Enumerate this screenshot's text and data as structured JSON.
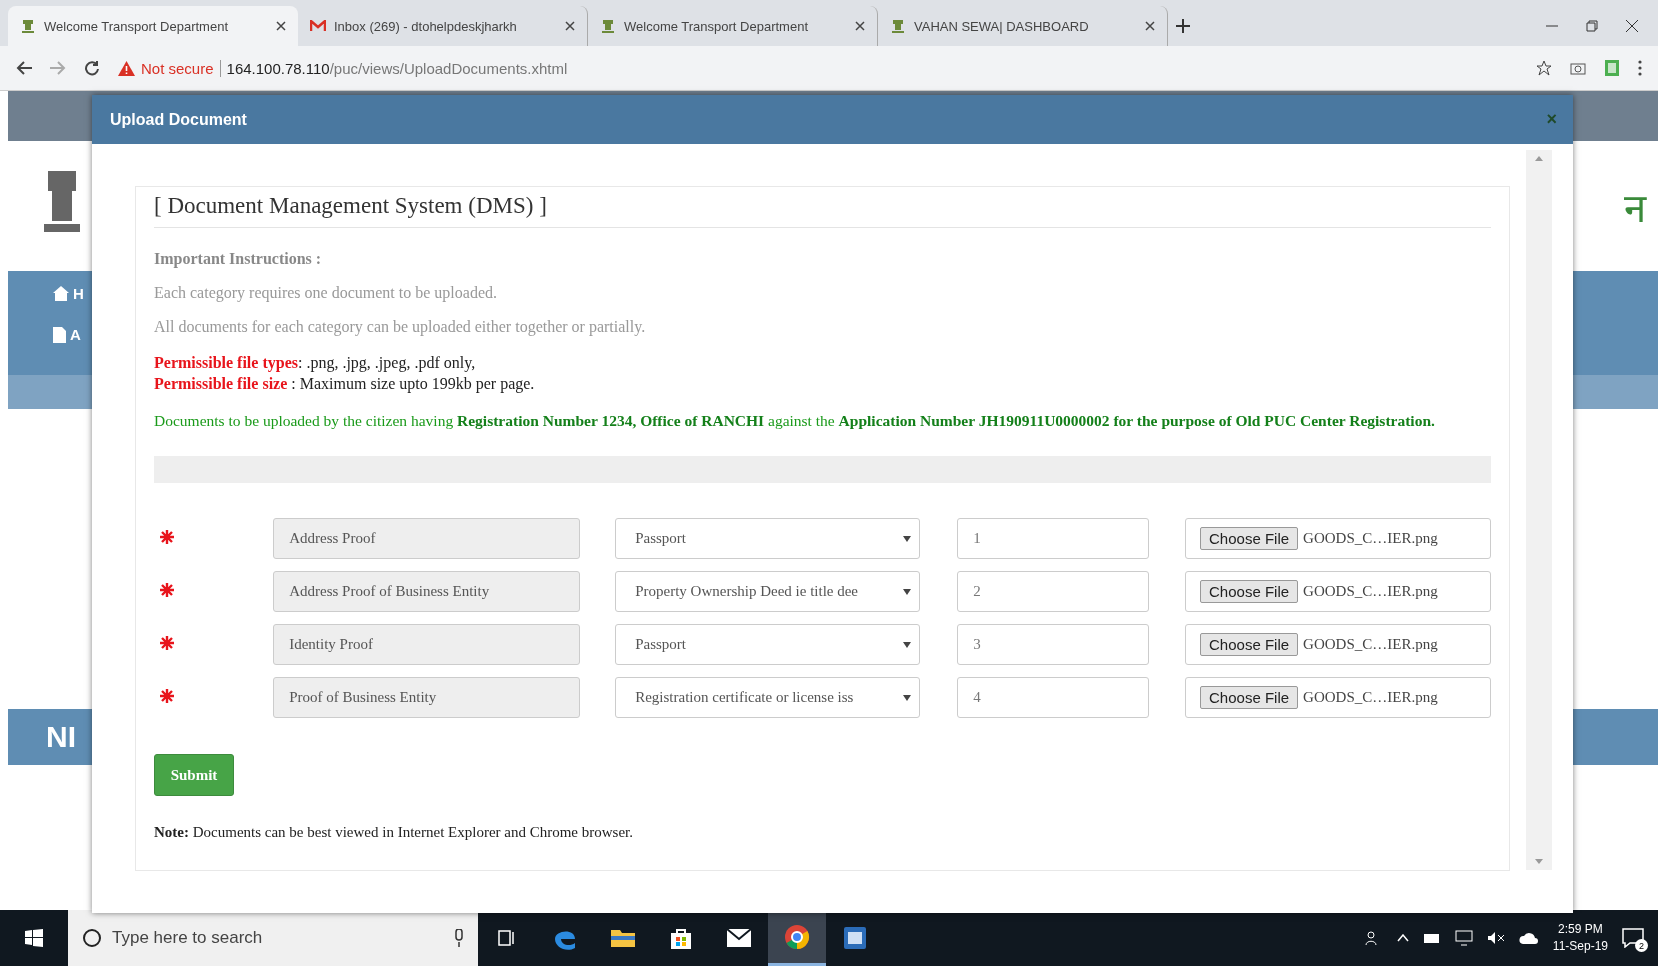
{
  "browser": {
    "tabs": [
      {
        "title": "Welcome Transport Department",
        "kind": "emblem",
        "selected": true
      },
      {
        "title": "Inbox (269) - dtohelpdeskjharkh",
        "kind": "mail",
        "selected": false
      },
      {
        "title": "Welcome Transport Department",
        "kind": "emblem",
        "selected": false
      },
      {
        "title": "VAHAN SEWA| DASHBOARD",
        "kind": "emblem",
        "selected": false
      }
    ],
    "security": "Not secure",
    "url_host": "164.100.78.110",
    "url_path": "/puc/views/UploadDocuments.xhtml"
  },
  "background_page": {
    "nav_items": [
      "H",
      "A"
    ],
    "footer_text": "NI",
    "banner_fragment": "न"
  },
  "modal": {
    "title": "Upload Document",
    "close": "×",
    "heading": "[ Document Management System (DMS) ]",
    "instructions_title": "Important Instructions :",
    "instructions": [
      "Each category requires one document to be uploaded.",
      "All documents for each category can be uploaded either together or partially."
    ],
    "rules": [
      {
        "label": "Permissible file types",
        "value": ": .png, .jpg, .jpeg, .pdf only,"
      },
      {
        "label": "Permissible file size",
        "value": " : Maximum size upto 199kb per page."
      }
    ],
    "notice": "Documents to be uploaded by the citizen having **Registration Number 1234, Office of RANCHI** against the **Application Number JH190911U0000002 for the purpose of Old PUC Center Registration.**",
    "documents": [
      {
        "required": true,
        "category": "Address Proof",
        "document": "Passport",
        "number": "1",
        "button": "Choose File",
        "file": "GOODS_C…IER.png"
      },
      {
        "required": true,
        "category": "Address Proof of Business Entity",
        "document": "Property Ownership Deed ie title dee",
        "number": "2",
        "button": "Choose File",
        "file": "GOODS_C…IER.png"
      },
      {
        "required": true,
        "category": "Identity Proof",
        "document": "Passport",
        "number": "3",
        "button": "Choose File",
        "file": "GOODS_C…IER.png"
      },
      {
        "required": true,
        "category": "Proof of Business Entity",
        "document": "Registration certificate or license iss",
        "number": "4",
        "button": "Choose File",
        "file": "GOODS_C…IER.png"
      }
    ],
    "submit": "Submit",
    "note_label": "Note:",
    "note": " Documents can be best viewed in Internet Explorer and Chrome browser."
  },
  "taskbar": {
    "search_placeholder": "Type here to search",
    "apps": [
      {
        "kind": "edge",
        "selected": false
      },
      {
        "kind": "folder",
        "selected": false
      },
      {
        "kind": "store",
        "selected": false
      },
      {
        "kind": "mail",
        "selected": false
      },
      {
        "kind": "chrome",
        "selected": true
      },
      {
        "kind": "window",
        "selected": false
      }
    ],
    "time": "2:59 PM",
    "date": "11-Sep-19",
    "notifications": "2"
  }
}
